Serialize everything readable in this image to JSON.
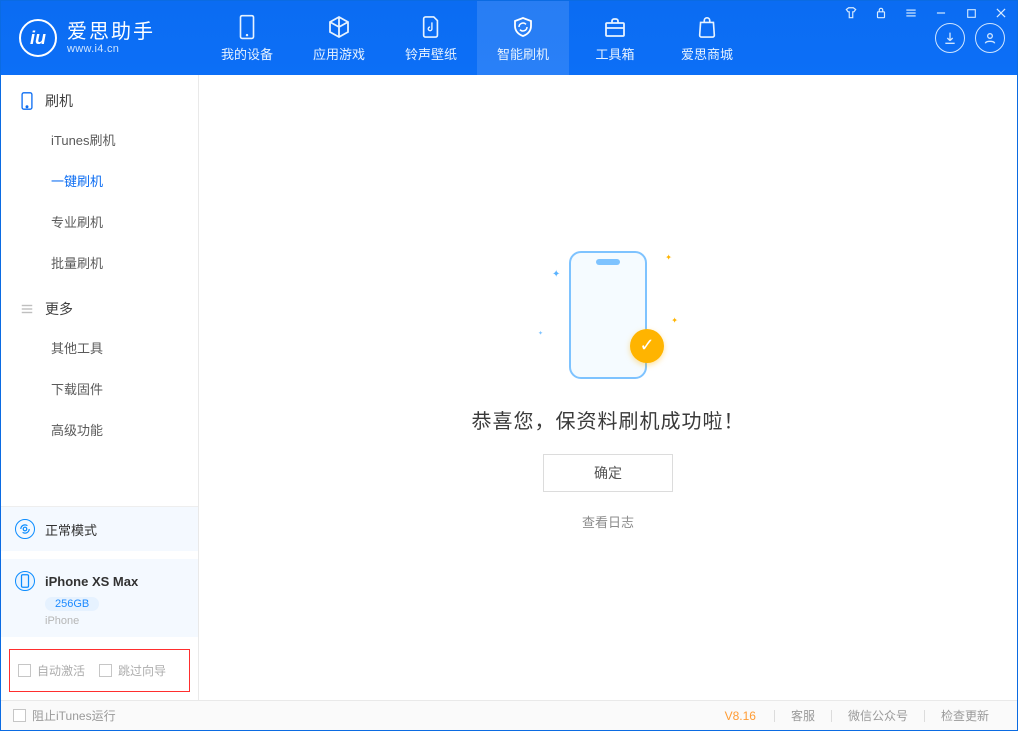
{
  "brand": {
    "name": "爱思助手",
    "url": "www.i4.cn"
  },
  "nav": {
    "items": [
      {
        "label": "我的设备"
      },
      {
        "label": "应用游戏"
      },
      {
        "label": "铃声壁纸"
      },
      {
        "label": "智能刷机"
      },
      {
        "label": "工具箱"
      },
      {
        "label": "爱思商城"
      }
    ],
    "activeIndex": 3
  },
  "sidebar": {
    "groups": [
      {
        "title": "刷机",
        "items": [
          "iTunes刷机",
          "一键刷机",
          "专业刷机",
          "批量刷机"
        ],
        "activeItem": "一键刷机"
      },
      {
        "title": "更多",
        "items": [
          "其他工具",
          "下载固件",
          "高级功能"
        ]
      }
    ],
    "mode": "正常模式",
    "device": {
      "name": "iPhone XS Max",
      "capacity": "256GB",
      "platform": "iPhone"
    },
    "options": {
      "autoActivate": "自动激活",
      "skipGuide": "跳过向导"
    }
  },
  "main": {
    "successMessage": "恭喜您，保资料刷机成功啦！",
    "confirmButton": "确定",
    "viewLog": "查看日志"
  },
  "footer": {
    "blockItunes": "阻止iTunes运行",
    "version": "V8.16",
    "links": [
      "客服",
      "微信公众号",
      "检查更新"
    ]
  },
  "colors": {
    "primary": "#0b6cf2",
    "accent": "#ffb400",
    "highlightBorder": "#ff2e2e"
  }
}
